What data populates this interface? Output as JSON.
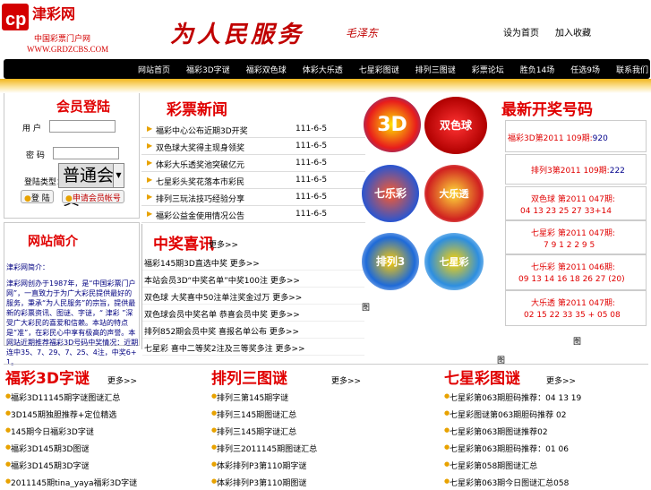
{
  "header": {
    "logo_main": "津彩网",
    "logo_sub": "中国彩票门户网",
    "logo_url_text": "WWW.GRDZCBS.COM",
    "slogan": "为人民服务",
    "slogan_signature": "毛泽东",
    "top_links": [
      "设为首页",
      "加入收藏"
    ]
  },
  "nav": {
    "items": [
      "网站首页",
      "福彩3D字谜",
      "福彩双色球",
      "体彩大乐透",
      "七星彩图谜",
      "排列三图谜",
      "彩票论坛",
      "胜负14场",
      "任选9场",
      "联系我们"
    ]
  },
  "login": {
    "title": "会员登陆",
    "username_label": "用 户",
    "password_label": "密 码",
    "select_label": "登陆类型：",
    "select_value": "普通会员",
    "login_button": "登 陆",
    "register_button": "申请会员帐号"
  },
  "intro": {
    "title": "网站简介",
    "heading": "津彩网简介：",
    "body": "津彩网创办于1987年，是“中国彩票门户网”，一直致力于为广大彩民提供最好的服务，秉承“为人民服务”的宗旨，提供最新的彩票资讯、图谜、字谜，“ 津彩 ”深受广大彩民的喜爱和信赖。本站的特点是“准”，在彩民心中享有极高的声誉。本网站近期推荐福彩3D号码中奖情况：近期连中35、7、29、7、25、4注，中奖6+1。"
  },
  "news": {
    "title": "彩票新闻",
    "rows": [
      {
        "title": "福彩中心公布近期3D开奖",
        "date": "111-6-5"
      },
      {
        "title": "双色球大奖得主现身领奖",
        "date": "111-6-5"
      },
      {
        "title": "体彩大乐透奖池突破亿元",
        "date": "111-6-5"
      },
      {
        "title": "七星彩头奖花落本市彩民",
        "date": "111-6-5"
      },
      {
        "title": "排列三玩法技巧经验分享",
        "date": "111-6-5"
      },
      {
        "title": "福彩公益金使用情况公告",
        "date": "111-6-5"
      }
    ]
  },
  "prize": {
    "title": "中奖喜讯",
    "more": "更多>>",
    "rows": [
      {
        "text": "福彩145期3D直选中奖",
        "more": "更多>>"
      },
      {
        "text": "本站会员3D“中奖名单”中奖100注",
        "more": "更多>>"
      },
      {
        "text": "双色球 大奖喜中50注单注奖金过万",
        "more": "更多>>"
      },
      {
        "text": "双色球会员中奖名单 恭喜会员中奖",
        "more": "更多>>"
      },
      {
        "text": "排列852期会员中奖 喜报名单公布",
        "more": "更多>>"
      },
      {
        "text": "七星彩 喜中二等奖2注及三等奖多注",
        "more": "更多>>"
      }
    ]
  },
  "logos": [
    "3D",
    "双色球",
    "七乐彩",
    "大乐透",
    "排列3",
    "七星彩"
  ],
  "stray": [
    "图",
    "图",
    "图"
  ],
  "draw": {
    "title": "最新开奖号码",
    "rows": [
      {
        "name": "福彩3D",
        "period": "第2011 109期:",
        "numbers": "920"
      },
      {
        "name": "排列3",
        "period": "第2011 109期:",
        "numbers": "222"
      },
      {
        "name": "双色球",
        "period": "第2011 047期:",
        "numbers": "04 13 23 25 27 33+14"
      },
      {
        "name": "七星彩",
        "period": "第2011 047期:",
        "numbers": "7 9 1 2 2 9 5"
      },
      {
        "name": "七乐彩",
        "period": "第2011 046期:",
        "numbers": "09 13 14 16 18 26 27 (20)"
      },
      {
        "name": "大乐透",
        "period": "第2011 047期:",
        "numbers": "02 15 22 33 35 + 05 08"
      }
    ]
  },
  "columns": [
    {
      "title": "福彩3D字谜",
      "more": "更多>>",
      "rows": [
        "福彩3D11145期字谜图谜汇总",
        "3D145期独胆推荐+定位精选",
        "145期今日福彩3D字谜",
        "福彩3D145期3D图谜",
        "福彩3D145期3D字谜",
        "2011145期tina_yaya福彩3D字谜"
      ]
    },
    {
      "title": "排列三图谜",
      "more": "更多>>",
      "rows": [
        "排列三第145期字谜",
        "排列三145期图谜汇总",
        "排列三145期字谜汇总",
        "排列三2011145期图谜汇总",
        "体彩排列P3第110期字谜",
        "体彩排列P3第110期图谜"
      ]
    },
    {
      "title": "七星彩图谜",
      "more": "更多>>",
      "rows": [
        "七星彩第063期胆码推荐：04 13 19",
        "七星彩图谜第063期胆码推荐 02",
        "七星彩第063期图谜推荐02",
        "七星彩第063期胆码推荐：01 06",
        "七星彩第058期图谜汇总",
        "七星彩第063期今日图谜汇总058"
      ]
    }
  ],
  "colors": {
    "accent_red": "#e00000",
    "nav_bg": "#000000",
    "band_gold": "#f2b61d",
    "link_navy": "#000080"
  }
}
